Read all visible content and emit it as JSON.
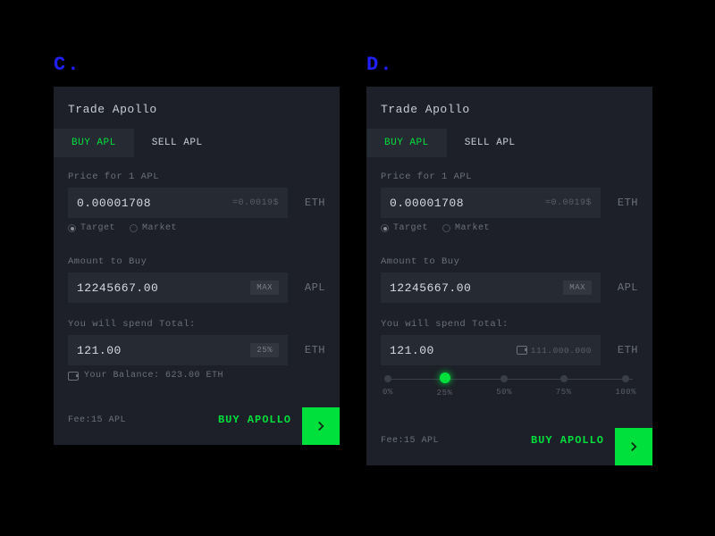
{
  "variants": {
    "c": "C.",
    "d": "D."
  },
  "card": {
    "title": "Trade Apollo",
    "tabs": {
      "buy": "BUY APL",
      "sell": "SELL APL"
    },
    "price": {
      "label": "Price for 1 APL",
      "value": "0.00001708",
      "usd": "=0.0019$",
      "unit": "ETH"
    },
    "radios": {
      "target": "Target",
      "market": "Market"
    },
    "amount": {
      "label": "Amount to Buy",
      "value": "12245667.00",
      "max": "MAX",
      "unit": "APL"
    },
    "total": {
      "label": "You will spend Total:",
      "value": "121.00",
      "pct": "25%",
      "unit": "ETH",
      "inline_balance": "111.000.000"
    },
    "balance": "Your Balance: 623.00 ETH",
    "slider": [
      "0%",
      "25%",
      "50%",
      "75%",
      "100%"
    ],
    "fee": "Fee:15 APL",
    "action": "BUY APOLLO"
  }
}
